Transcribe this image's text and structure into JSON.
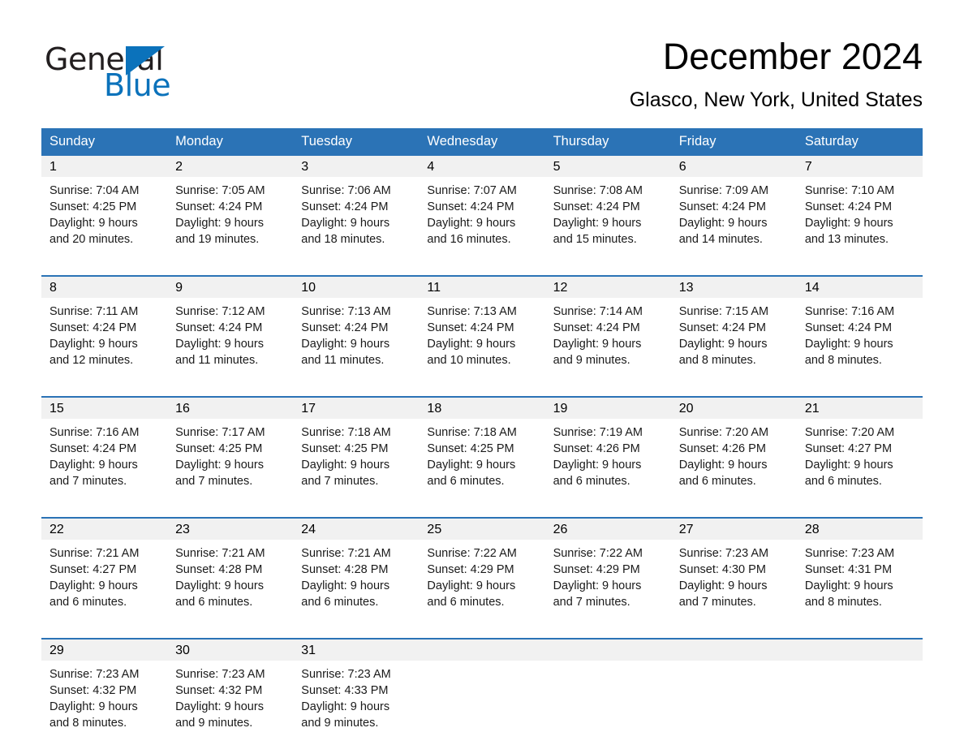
{
  "brand": {
    "word_one": "General",
    "word_two": "Blue",
    "triangle_color": "#0b72bb",
    "text_color": "#231f20"
  },
  "header": {
    "month_title": "December 2024",
    "location": "Glasco, New York, United States"
  },
  "theme": {
    "header_blue": "#2b73b6",
    "daynum_gray": "#f1f1f1",
    "text_black": "#000000"
  },
  "calendar": {
    "weekday_headers": [
      "Sunday",
      "Monday",
      "Tuesday",
      "Wednesday",
      "Thursday",
      "Friday",
      "Saturday"
    ],
    "weeks": [
      [
        {
          "day": "1",
          "sunrise": "Sunrise: 7:04 AM",
          "sunset": "Sunset: 4:25 PM",
          "daylight_line1": "Daylight: 9 hours",
          "daylight_line2": "and 20 minutes."
        },
        {
          "day": "2",
          "sunrise": "Sunrise: 7:05 AM",
          "sunset": "Sunset: 4:24 PM",
          "daylight_line1": "Daylight: 9 hours",
          "daylight_line2": "and 19 minutes."
        },
        {
          "day": "3",
          "sunrise": "Sunrise: 7:06 AM",
          "sunset": "Sunset: 4:24 PM",
          "daylight_line1": "Daylight: 9 hours",
          "daylight_line2": "and 18 minutes."
        },
        {
          "day": "4",
          "sunrise": "Sunrise: 7:07 AM",
          "sunset": "Sunset: 4:24 PM",
          "daylight_line1": "Daylight: 9 hours",
          "daylight_line2": "and 16 minutes."
        },
        {
          "day": "5",
          "sunrise": "Sunrise: 7:08 AM",
          "sunset": "Sunset: 4:24 PM",
          "daylight_line1": "Daylight: 9 hours",
          "daylight_line2": "and 15 minutes."
        },
        {
          "day": "6",
          "sunrise": "Sunrise: 7:09 AM",
          "sunset": "Sunset: 4:24 PM",
          "daylight_line1": "Daylight: 9 hours",
          "daylight_line2": "and 14 minutes."
        },
        {
          "day": "7",
          "sunrise": "Sunrise: 7:10 AM",
          "sunset": "Sunset: 4:24 PM",
          "daylight_line1": "Daylight: 9 hours",
          "daylight_line2": "and 13 minutes."
        }
      ],
      [
        {
          "day": "8",
          "sunrise": "Sunrise: 7:11 AM",
          "sunset": "Sunset: 4:24 PM",
          "daylight_line1": "Daylight: 9 hours",
          "daylight_line2": "and 12 minutes."
        },
        {
          "day": "9",
          "sunrise": "Sunrise: 7:12 AM",
          "sunset": "Sunset: 4:24 PM",
          "daylight_line1": "Daylight: 9 hours",
          "daylight_line2": "and 11 minutes."
        },
        {
          "day": "10",
          "sunrise": "Sunrise: 7:13 AM",
          "sunset": "Sunset: 4:24 PM",
          "daylight_line1": "Daylight: 9 hours",
          "daylight_line2": "and 11 minutes."
        },
        {
          "day": "11",
          "sunrise": "Sunrise: 7:13 AM",
          "sunset": "Sunset: 4:24 PM",
          "daylight_line1": "Daylight: 9 hours",
          "daylight_line2": "and 10 minutes."
        },
        {
          "day": "12",
          "sunrise": "Sunrise: 7:14 AM",
          "sunset": "Sunset: 4:24 PM",
          "daylight_line1": "Daylight: 9 hours",
          "daylight_line2": "and 9 minutes."
        },
        {
          "day": "13",
          "sunrise": "Sunrise: 7:15 AM",
          "sunset": "Sunset: 4:24 PM",
          "daylight_line1": "Daylight: 9 hours",
          "daylight_line2": "and 8 minutes."
        },
        {
          "day": "14",
          "sunrise": "Sunrise: 7:16 AM",
          "sunset": "Sunset: 4:24 PM",
          "daylight_line1": "Daylight: 9 hours",
          "daylight_line2": "and 8 minutes."
        }
      ],
      [
        {
          "day": "15",
          "sunrise": "Sunrise: 7:16 AM",
          "sunset": "Sunset: 4:24 PM",
          "daylight_line1": "Daylight: 9 hours",
          "daylight_line2": "and 7 minutes."
        },
        {
          "day": "16",
          "sunrise": "Sunrise: 7:17 AM",
          "sunset": "Sunset: 4:25 PM",
          "daylight_line1": "Daylight: 9 hours",
          "daylight_line2": "and 7 minutes."
        },
        {
          "day": "17",
          "sunrise": "Sunrise: 7:18 AM",
          "sunset": "Sunset: 4:25 PM",
          "daylight_line1": "Daylight: 9 hours",
          "daylight_line2": "and 7 minutes."
        },
        {
          "day": "18",
          "sunrise": "Sunrise: 7:18 AM",
          "sunset": "Sunset: 4:25 PM",
          "daylight_line1": "Daylight: 9 hours",
          "daylight_line2": "and 6 minutes."
        },
        {
          "day": "19",
          "sunrise": "Sunrise: 7:19 AM",
          "sunset": "Sunset: 4:26 PM",
          "daylight_line1": "Daylight: 9 hours",
          "daylight_line2": "and 6 minutes."
        },
        {
          "day": "20",
          "sunrise": "Sunrise: 7:20 AM",
          "sunset": "Sunset: 4:26 PM",
          "daylight_line1": "Daylight: 9 hours",
          "daylight_line2": "and 6 minutes."
        },
        {
          "day": "21",
          "sunrise": "Sunrise: 7:20 AM",
          "sunset": "Sunset: 4:27 PM",
          "daylight_line1": "Daylight: 9 hours",
          "daylight_line2": "and 6 minutes."
        }
      ],
      [
        {
          "day": "22",
          "sunrise": "Sunrise: 7:21 AM",
          "sunset": "Sunset: 4:27 PM",
          "daylight_line1": "Daylight: 9 hours",
          "daylight_line2": "and 6 minutes."
        },
        {
          "day": "23",
          "sunrise": "Sunrise: 7:21 AM",
          "sunset": "Sunset: 4:28 PM",
          "daylight_line1": "Daylight: 9 hours",
          "daylight_line2": "and 6 minutes."
        },
        {
          "day": "24",
          "sunrise": "Sunrise: 7:21 AM",
          "sunset": "Sunset: 4:28 PM",
          "daylight_line1": "Daylight: 9 hours",
          "daylight_line2": "and 6 minutes."
        },
        {
          "day": "25",
          "sunrise": "Sunrise: 7:22 AM",
          "sunset": "Sunset: 4:29 PM",
          "daylight_line1": "Daylight: 9 hours",
          "daylight_line2": "and 6 minutes."
        },
        {
          "day": "26",
          "sunrise": "Sunrise: 7:22 AM",
          "sunset": "Sunset: 4:29 PM",
          "daylight_line1": "Daylight: 9 hours",
          "daylight_line2": "and 7 minutes."
        },
        {
          "day": "27",
          "sunrise": "Sunrise: 7:23 AM",
          "sunset": "Sunset: 4:30 PM",
          "daylight_line1": "Daylight: 9 hours",
          "daylight_line2": "and 7 minutes."
        },
        {
          "day": "28",
          "sunrise": "Sunrise: 7:23 AM",
          "sunset": "Sunset: 4:31 PM",
          "daylight_line1": "Daylight: 9 hours",
          "daylight_line2": "and 8 minutes."
        }
      ],
      [
        {
          "day": "29",
          "sunrise": "Sunrise: 7:23 AM",
          "sunset": "Sunset: 4:32 PM",
          "daylight_line1": "Daylight: 9 hours",
          "daylight_line2": "and 8 minutes."
        },
        {
          "day": "30",
          "sunrise": "Sunrise: 7:23 AM",
          "sunset": "Sunset: 4:32 PM",
          "daylight_line1": "Daylight: 9 hours",
          "daylight_line2": "and 9 minutes."
        },
        {
          "day": "31",
          "sunrise": "Sunrise: 7:23 AM",
          "sunset": "Sunset: 4:33 PM",
          "daylight_line1": "Daylight: 9 hours",
          "daylight_line2": "and 9 minutes."
        },
        {
          "day": "",
          "sunrise": "",
          "sunset": "",
          "daylight_line1": "",
          "daylight_line2": ""
        },
        {
          "day": "",
          "sunrise": "",
          "sunset": "",
          "daylight_line1": "",
          "daylight_line2": ""
        },
        {
          "day": "",
          "sunrise": "",
          "sunset": "",
          "daylight_line1": "",
          "daylight_line2": ""
        },
        {
          "day": "",
          "sunrise": "",
          "sunset": "",
          "daylight_line1": "",
          "daylight_line2": ""
        }
      ]
    ]
  }
}
